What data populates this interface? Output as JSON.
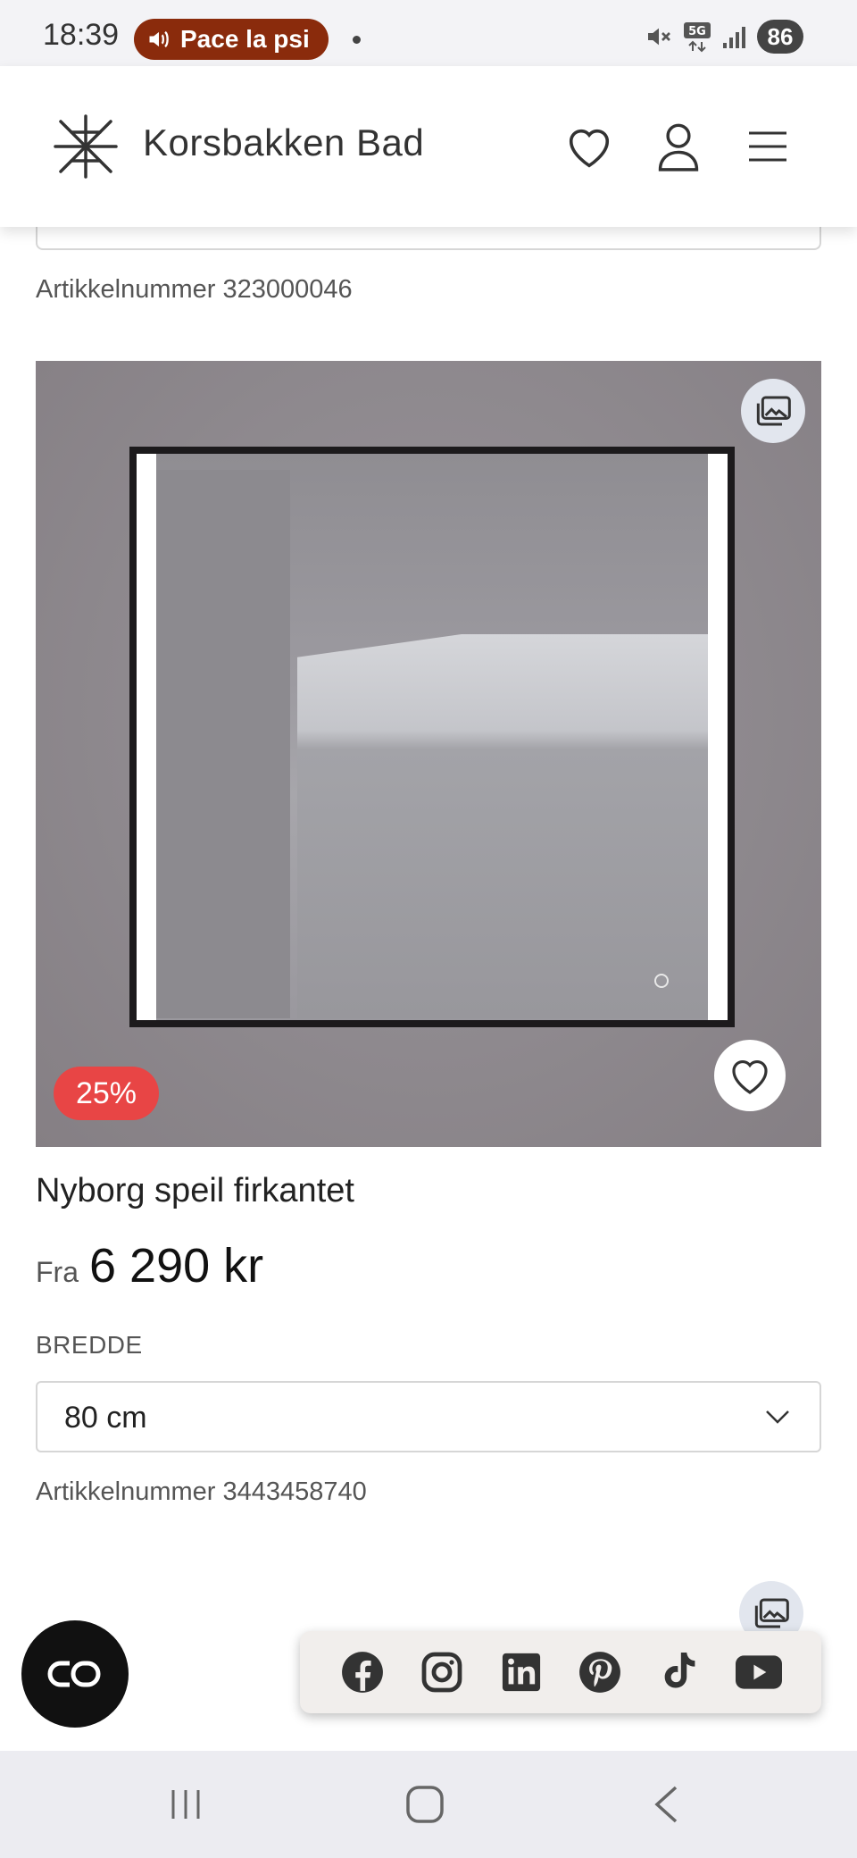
{
  "status_bar": {
    "time": "18:39",
    "media_title": "Pace la psi",
    "battery": "86",
    "network": "5G"
  },
  "header": {
    "logo_text": "Korsbakken Bad"
  },
  "previous_product": {
    "article_number": "Artikkelnummer 323000046"
  },
  "product": {
    "discount": "25%",
    "name": "Nyborg speil firkantet",
    "price_prefix": "Fra",
    "price": "6 290 kr",
    "option_label": "BREDDE",
    "option_value": "80 cm",
    "article_number": "Artikkelnummer 3443458740"
  },
  "social": [
    "facebook-icon",
    "instagram-icon",
    "linkedin-icon",
    "pinterest-icon",
    "tiktok-icon",
    "youtube-icon"
  ],
  "colors": {
    "discount_badge": "#e84545",
    "media_pill": "#8a2b0c",
    "chat_button": "#111111"
  }
}
